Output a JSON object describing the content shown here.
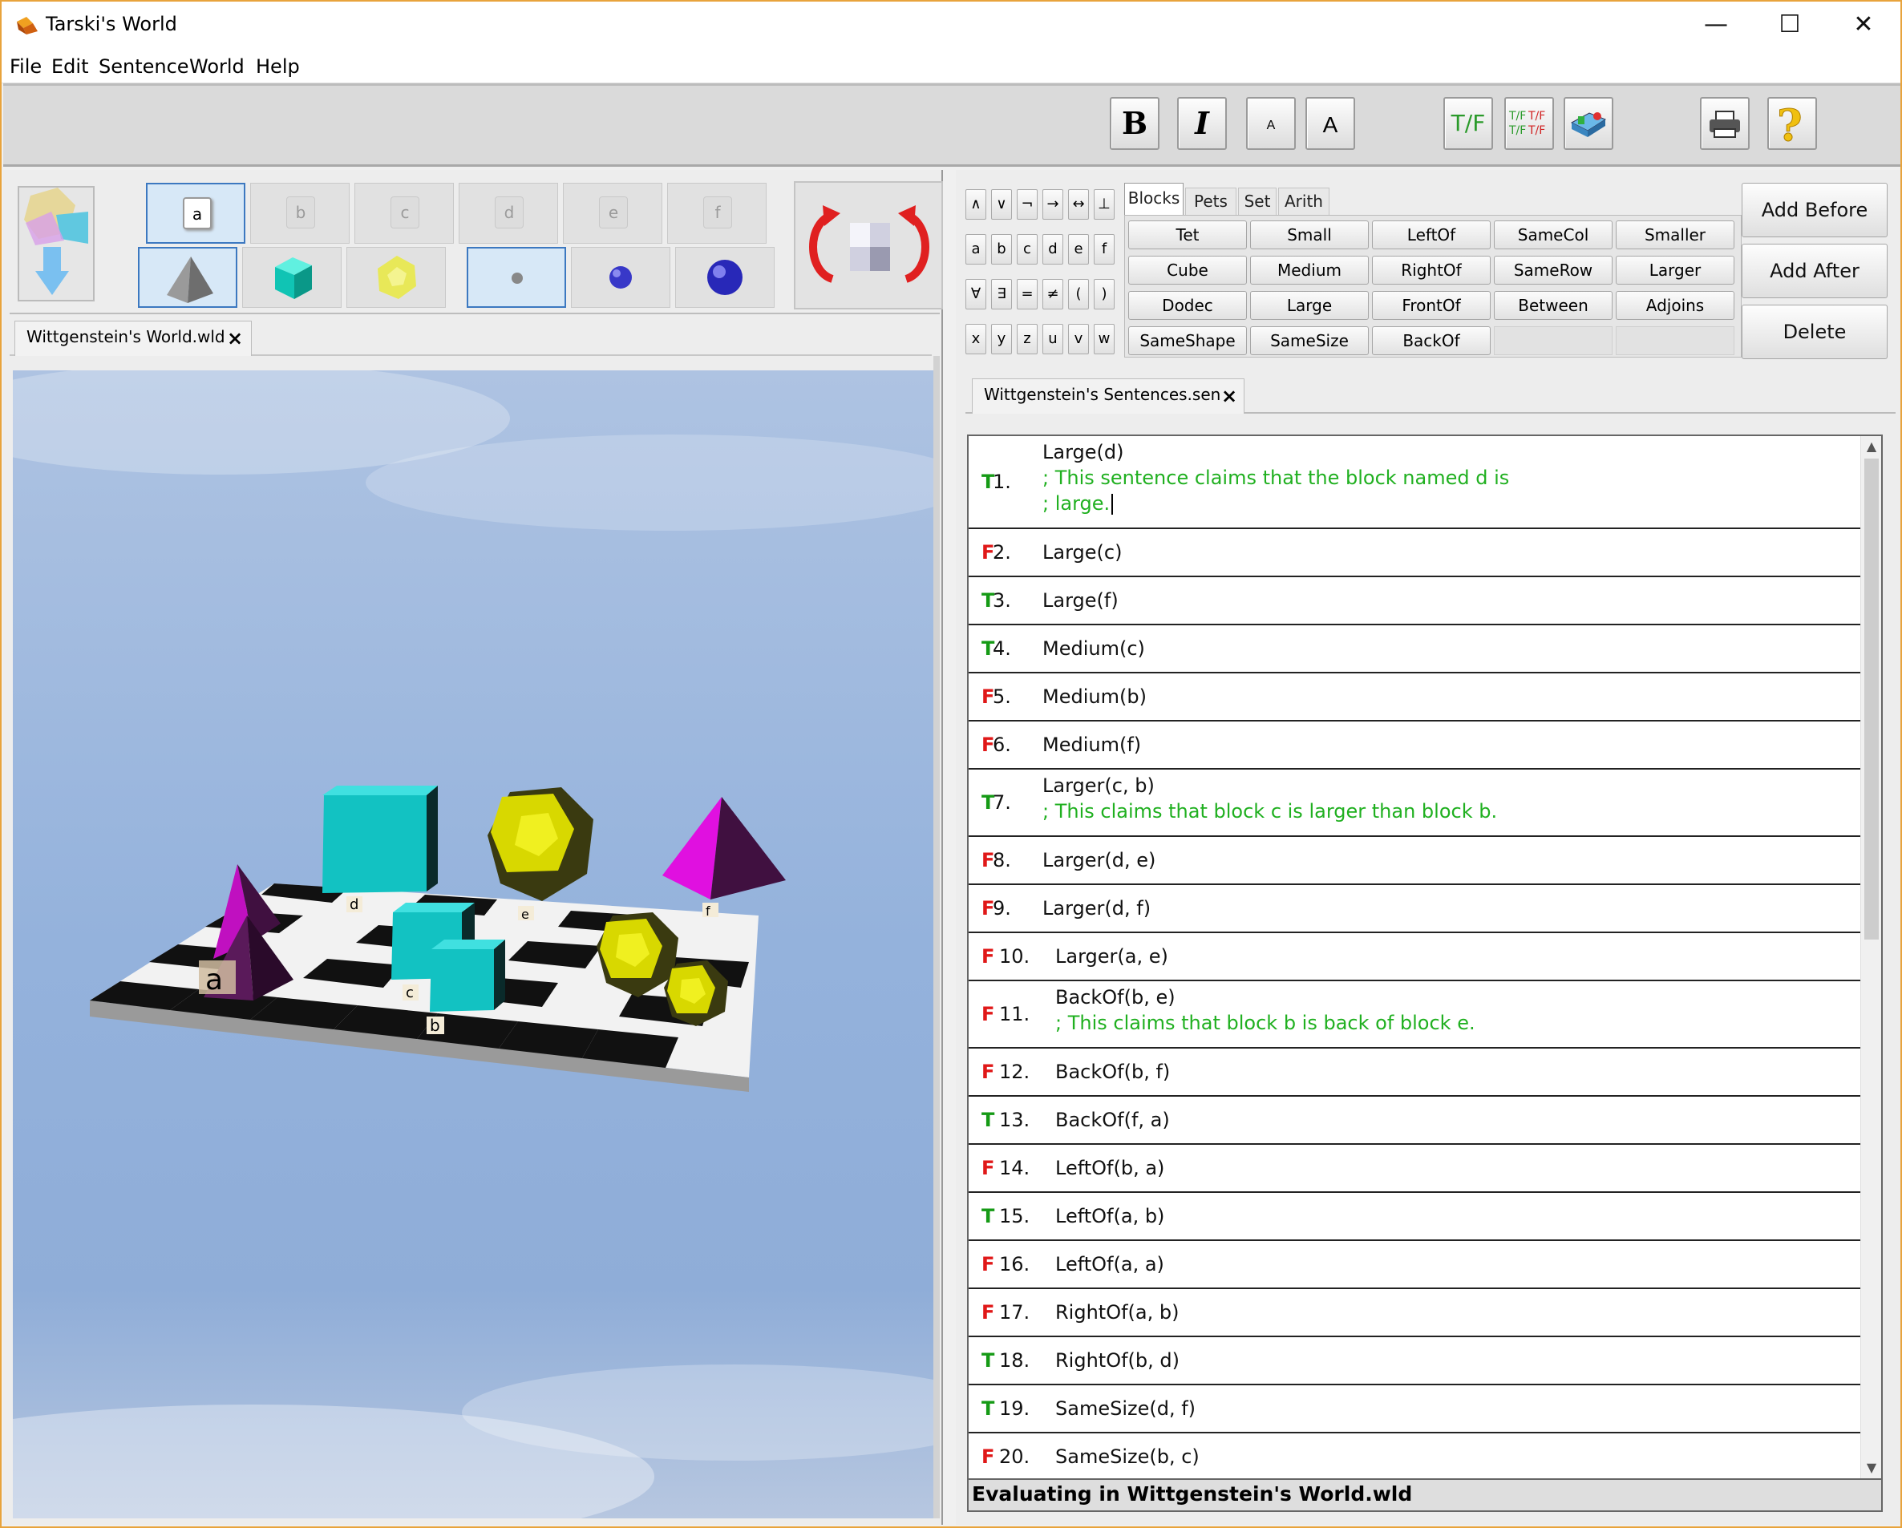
{
  "window": {
    "title": "Tarski's World",
    "minimize": "—",
    "maximize": "☐",
    "close": "✕"
  },
  "menu": [
    "File",
    "Edit",
    "Sentence",
    "World",
    "Help"
  ],
  "toolbar": {
    "bold": "B",
    "italic": "I",
    "font_smaller": "A",
    "font_larger": "A",
    "verify": "T/F",
    "verify_all": "T/F T/F / T/F T/F"
  },
  "palette": {
    "names": [
      "a",
      "b",
      "c",
      "d",
      "e",
      "f"
    ],
    "selected_name": "a",
    "shapes": [
      "tetrahedron",
      "cube",
      "dodecahedron",
      "small",
      "medium",
      "large"
    ]
  },
  "world": {
    "tab_label": "Wittgenstein's World.wld",
    "labels": {
      "a": "a",
      "b": "b",
      "c": "c",
      "d": "d",
      "e": "e",
      "f": "f"
    },
    "colors": {
      "sky": "#94b2dc",
      "tet": "#cc10cc",
      "cube": "#10c4c4",
      "dodec": "#e0e010"
    }
  },
  "keypad": [
    [
      "∧",
      "∨",
      "¬",
      "→",
      "↔",
      "⊥"
    ],
    [
      "a",
      "b",
      "c",
      "d",
      "e",
      "f"
    ],
    [
      "∀",
      "∃",
      "=",
      "≠",
      "(",
      ")"
    ],
    [
      "x",
      "y",
      "z",
      "u",
      "v",
      "w"
    ]
  ],
  "predicate_tabs": [
    "Blocks",
    "Pets",
    "Set",
    "Arith"
  ],
  "active_tab": "Blocks",
  "predicates": [
    [
      "Tet",
      "Small",
      "LeftOf",
      "SameCol",
      "Smaller"
    ],
    [
      "Cube",
      "Medium",
      "RightOf",
      "SameRow",
      "Larger"
    ],
    [
      "Dodec",
      "Large",
      "FrontOf",
      "Between",
      "Adjoins"
    ],
    [
      "SameShape",
      "SameSize",
      "BackOf",
      "",
      ""
    ]
  ],
  "side_buttons": {
    "add_before": "Add Before",
    "add_after": "Add After",
    "delete": "Delete"
  },
  "sentences_tab": {
    "label": "Wittgenstein's Sentences.sen"
  },
  "sentences": [
    {
      "tv": "T",
      "num": "1.",
      "text": "Large(d)",
      "comment": [
        "; This sentence claims that the block named d is",
        "; large."
      ]
    },
    {
      "tv": "F",
      "num": "2.",
      "text": "Large(c)",
      "comment": []
    },
    {
      "tv": "T",
      "num": "3.",
      "text": "Large(f)",
      "comment": []
    },
    {
      "tv": "T",
      "num": "4.",
      "text": "Medium(c)",
      "comment": []
    },
    {
      "tv": "F",
      "num": "5.",
      "text": "Medium(b)",
      "comment": []
    },
    {
      "tv": "F",
      "num": "6.",
      "text": "Medium(f)",
      "comment": []
    },
    {
      "tv": "T",
      "num": "7.",
      "text": "Larger(c, b)",
      "comment": [
        "; This claims that block c is larger than block b."
      ]
    },
    {
      "tv": "F",
      "num": "8.",
      "text": "Larger(d, e)",
      "comment": []
    },
    {
      "tv": "F",
      "num": "9.",
      "text": "Larger(d, f)",
      "comment": []
    },
    {
      "tv": "F",
      "num": "10.",
      "text": "Larger(a, e)",
      "comment": []
    },
    {
      "tv": "F",
      "num": "11.",
      "text": "BackOf(b, e)",
      "comment": [
        "; This claims that block b is back of block e."
      ]
    },
    {
      "tv": "F",
      "num": "12.",
      "text": "BackOf(b, f)",
      "comment": []
    },
    {
      "tv": "T",
      "num": "13.",
      "text": "BackOf(f, a)",
      "comment": []
    },
    {
      "tv": "F",
      "num": "14.",
      "text": "LeftOf(b, a)",
      "comment": []
    },
    {
      "tv": "T",
      "num": "15.",
      "text": "LeftOf(a, b)",
      "comment": []
    },
    {
      "tv": "F",
      "num": "16.",
      "text": "LeftOf(a, a)",
      "comment": []
    },
    {
      "tv": "F",
      "num": "17.",
      "text": "RightOf(a, b)",
      "comment": []
    },
    {
      "tv": "T",
      "num": "18.",
      "text": "RightOf(b, d)",
      "comment": []
    },
    {
      "tv": "T",
      "num": "19.",
      "text": "SameSize(d, f)",
      "comment": []
    },
    {
      "tv": "F",
      "num": "20.",
      "text": "SameSize(b, c)",
      "comment": []
    }
  ],
  "status": "Evaluating in Wittgenstein's World.wld"
}
